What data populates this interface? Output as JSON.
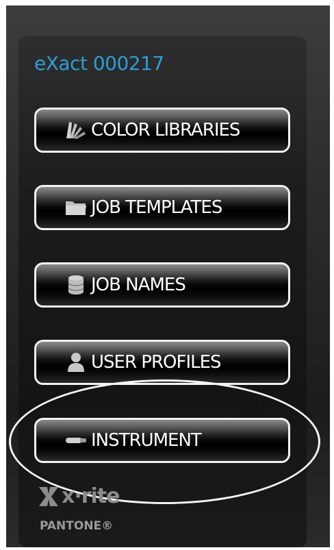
{
  "device": {
    "title": "eXact 000217"
  },
  "menu": {
    "items": [
      {
        "label": "COLOR LIBRARIES",
        "icon": "color-fan-icon"
      },
      {
        "label": "JOB TEMPLATES",
        "icon": "folder-icon"
      },
      {
        "label": "JOB NAMES",
        "icon": "database-icon"
      },
      {
        "label": "USER PROFILES",
        "icon": "user-icon"
      },
      {
        "label": "INSTRUMENT",
        "icon": "instrument-icon"
      }
    ]
  },
  "branding": {
    "xrite": "x·rite",
    "pantone": "PANTONE®"
  },
  "colors": {
    "accent": "#2a9fd8",
    "button_border": "#f2f2f2",
    "background": "#1c1c1c"
  }
}
